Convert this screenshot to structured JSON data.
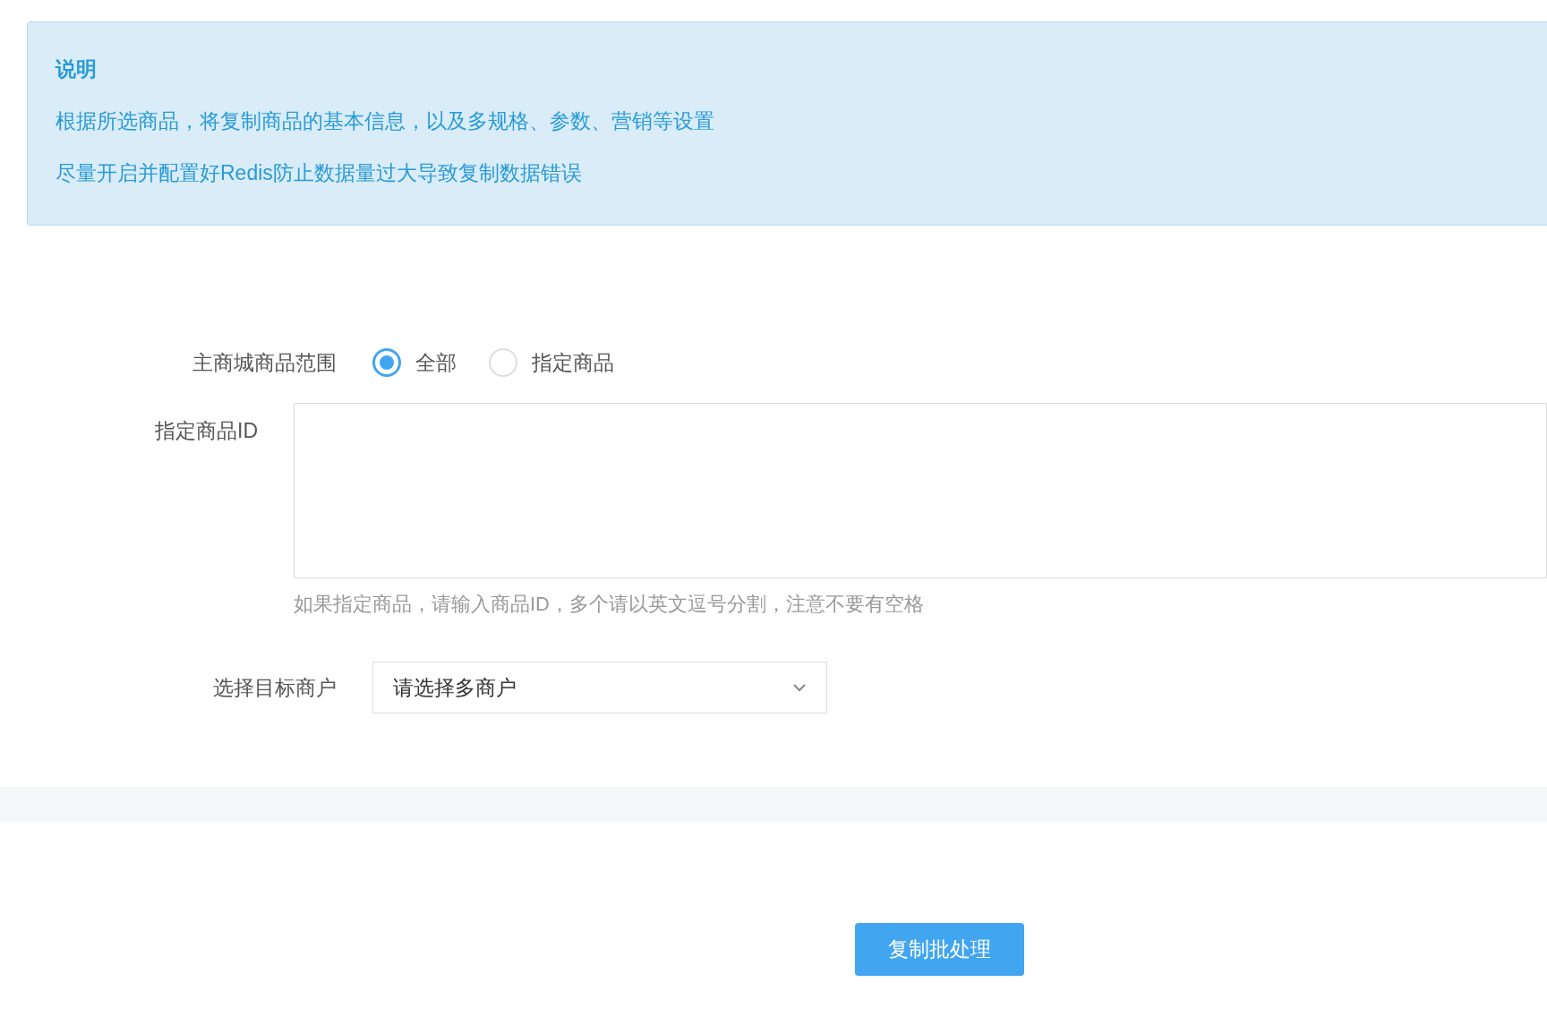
{
  "notice": {
    "title": "说明",
    "lines": [
      "根据所选商品，将复制商品的基本信息，以及多规格、参数、营销等设置",
      "尽量开启并配置好Redis防止数据量过大导致复制数据错误"
    ]
  },
  "form": {
    "scope": {
      "label": "主商城商品范围",
      "options": [
        {
          "label": "全部",
          "selected": true
        },
        {
          "label": "指定商品",
          "selected": false
        }
      ]
    },
    "ids": {
      "label": "指定商品ID",
      "help": "如果指定商品，请输入商品ID，多个请以英文逗号分割，注意不要有空格"
    },
    "merchant": {
      "label": "选择目标商户",
      "placeholder": "请选择多商户"
    }
  },
  "submit": "复制批处理"
}
